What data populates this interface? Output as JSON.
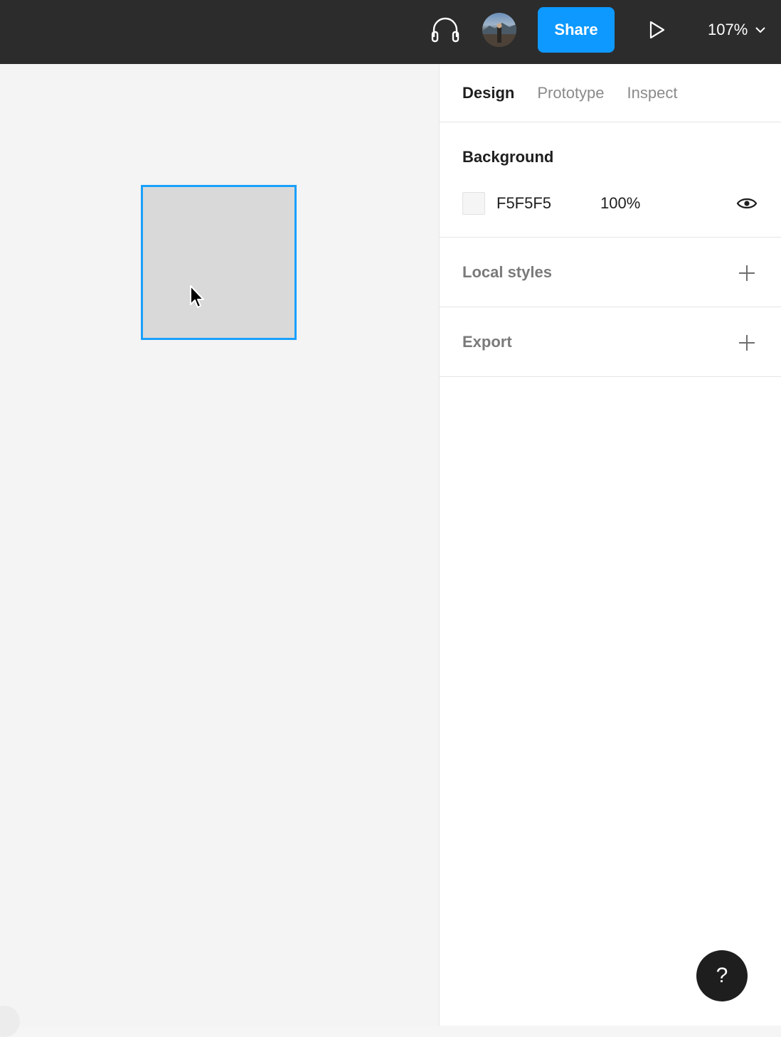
{
  "topbar": {
    "share_label": "Share",
    "zoom_label": "107%",
    "icons": {
      "audio": "headphones-icon",
      "avatar": "user-avatar",
      "play": "play-icon",
      "zoom_chevron": "chevron-down-icon"
    }
  },
  "panel": {
    "tabs": [
      {
        "label": "Design",
        "active": true
      },
      {
        "label": "Prototype",
        "active": false
      },
      {
        "label": "Inspect",
        "active": false
      }
    ],
    "background": {
      "title": "Background",
      "hex": "F5F5F5",
      "opacity": "100%"
    },
    "local_styles": {
      "title": "Local styles"
    },
    "export": {
      "title": "Export"
    },
    "help_label": "?"
  },
  "colors": {
    "topbar_bg": "#2c2c2c",
    "accent": "#0d99ff",
    "selection": "#18a0fb",
    "canvas_bg": "#f4f4f4",
    "frame_fill": "#d9d9d9"
  }
}
